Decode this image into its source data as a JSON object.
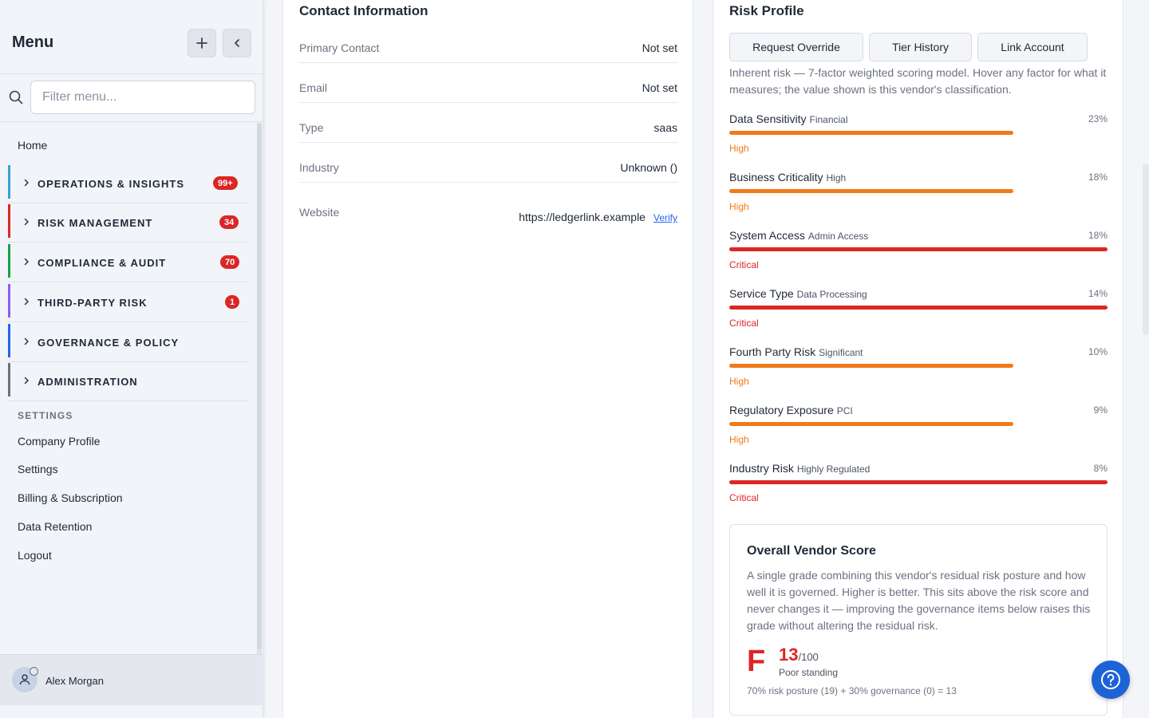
{
  "sidebar": {
    "title": "Menu",
    "search_placeholder": "Filter menu...",
    "home": "Home",
    "groups": [
      {
        "label": "OPERATIONS & INSIGHTS",
        "badge": "99+",
        "color": "#38a1d6"
      },
      {
        "label": "RISK MANAGEMENT",
        "badge": "34",
        "color": "#dc2626"
      },
      {
        "label": "COMPLIANCE & AUDIT",
        "badge": "70",
        "color": "#16a34a"
      },
      {
        "label": "THIRD-PARTY RISK",
        "badge": "1",
        "color": "#8b5cf6"
      },
      {
        "label": "GOVERNANCE & POLICY",
        "badge": "",
        "color": "#2563eb"
      },
      {
        "label": "ADMINISTRATION",
        "badge": "",
        "color": "#6b7280"
      }
    ],
    "settings_heading": "SETTINGS",
    "links": [
      "Company Profile",
      "Settings",
      "Billing & Subscription",
      "Data Retention",
      "Logout"
    ],
    "user_name": "Alex Morgan"
  },
  "contact": {
    "title": "Contact Information",
    "rows": [
      {
        "label": "Primary Contact",
        "value": "Not set"
      },
      {
        "label": "Email",
        "value": "Not set"
      },
      {
        "label": "Type",
        "value": "saas"
      },
      {
        "label": "Industry",
        "value": "Unknown ()"
      }
    ],
    "website_label": "Website",
    "website_value": "https://ledgerlink.example",
    "verify_label": "Verify"
  },
  "risk": {
    "title": "Risk Profile",
    "buttons": [
      "Request Override",
      "Tier History",
      "Link Account"
    ],
    "description": "Inherent risk — 7-factor weighted scoring model. Hover any factor for what it measures; the value shown is this vendor's classification.",
    "factors": [
      {
        "name": "Data Sensitivity",
        "sub": "Financial",
        "pct": "23%",
        "level": "High",
        "fill": 0.75
      },
      {
        "name": "Business Criticality",
        "sub": "High",
        "pct": "18%",
        "level": "High",
        "fill": 0.75
      },
      {
        "name": "System Access",
        "sub": "Admin Access",
        "pct": "18%",
        "level": "Critical",
        "fill": 1.0
      },
      {
        "name": "Service Type",
        "sub": "Data Processing",
        "pct": "14%",
        "level": "Critical",
        "fill": 1.0
      },
      {
        "name": "Fourth Party Risk",
        "sub": "Significant",
        "pct": "10%",
        "level": "High",
        "fill": 0.75
      },
      {
        "name": "Regulatory Exposure",
        "sub": "PCI",
        "pct": "9%",
        "level": "High",
        "fill": 0.75
      },
      {
        "name": "Industry Risk",
        "sub": "Highly Regulated",
        "pct": "8%",
        "level": "Critical",
        "fill": 1.0
      }
    ],
    "level_colors": {
      "High": "#f07a1a",
      "Critical": "#dc2626"
    }
  },
  "score": {
    "title": "Overall Vendor Score",
    "description": "A single grade combining this vendor's residual risk posture and how well it is governed. Higher is better. This sits above the risk score and never changes it — improving the governance items below raises this grade without altering the residual risk.",
    "grade": "F",
    "value": "13",
    "denominator": "/100",
    "standing": "Poor standing",
    "formula": "70% risk posture (19) + 30% governance (0) = 13"
  }
}
